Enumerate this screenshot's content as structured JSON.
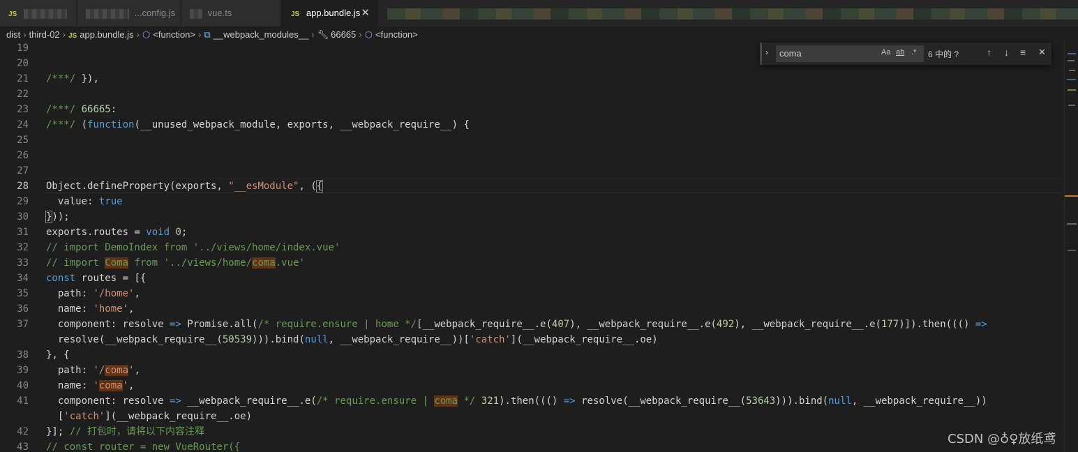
{
  "tabs": [
    {
      "label": "",
      "icon": "JS"
    },
    {
      "label": "...config.js"
    },
    {
      "label": "vue.ts"
    },
    {
      "label": "app.bundle.js",
      "icon": "JS",
      "active": true
    }
  ],
  "breadcrumb": {
    "items": [
      "dist",
      "third-02",
      "app.bundle.js",
      "<function>",
      "__webpack_modules__",
      "66665",
      "<function>"
    ]
  },
  "find": {
    "value": "coma",
    "match_case": "Aa",
    "whole_word": "ab",
    "regex": ".*",
    "count": "6 中的 ?",
    "prev": "↑",
    "next": "↓",
    "selection": "≡",
    "close": "✕",
    "toggle": "›"
  },
  "code": {
    "lines": [
      {
        "n": "19",
        "segs": []
      },
      {
        "n": "20",
        "segs": []
      },
      {
        "n": "21",
        "segs": [
          {
            "t": "/***/",
            "c": "c"
          },
          {
            "t": " }),",
            "c": "d"
          }
        ]
      },
      {
        "n": "22",
        "segs": []
      },
      {
        "n": "23",
        "segs": [
          {
            "t": "/***/",
            "c": "c"
          },
          {
            "t": " ",
            "c": "d"
          },
          {
            "t": "66665",
            "c": "n"
          },
          {
            "t": ":",
            "c": "d"
          }
        ]
      },
      {
        "n": "24",
        "segs": [
          {
            "t": "/***/",
            "c": "c"
          },
          {
            "t": " (",
            "c": "d"
          },
          {
            "t": "function",
            "c": "k"
          },
          {
            "t": "(__unused_webpack_module, exports, __webpack_require__) {",
            "c": "d"
          }
        ]
      },
      {
        "n": "25",
        "segs": []
      },
      {
        "n": "26",
        "segs": []
      },
      {
        "n": "27",
        "segs": []
      },
      {
        "n": "28",
        "current": true,
        "segs": [
          {
            "t": "Object.defineProperty(exports, ",
            "c": "d"
          },
          {
            "t": "\"__esModule\"",
            "c": "s"
          },
          {
            "t": ", (",
            "c": "d"
          },
          {
            "t": "{",
            "c": "d br"
          }
        ]
      },
      {
        "n": "29",
        "segs": [
          {
            "t": "  value: ",
            "c": "d"
          },
          {
            "t": "true",
            "c": "k"
          }
        ]
      },
      {
        "n": "30",
        "segs": [
          {
            "t": "}",
            "c": "d br"
          },
          {
            "t": "));",
            "c": "d"
          }
        ]
      },
      {
        "n": "31",
        "segs": [
          {
            "t": "exports.routes = ",
            "c": "d"
          },
          {
            "t": "void",
            "c": "k"
          },
          {
            "t": " ",
            "c": "d"
          },
          {
            "t": "0",
            "c": "n"
          },
          {
            "t": ";",
            "c": "d"
          }
        ]
      },
      {
        "n": "32",
        "segs": [
          {
            "t": "// import DemoIndex from '../views/home/index.vue'",
            "c": "c"
          }
        ]
      },
      {
        "n": "33",
        "segs": [
          {
            "t": "// import ",
            "c": "c"
          },
          {
            "t": "Coma",
            "c": "c hl"
          },
          {
            "t": " from '../views/home/",
            "c": "c"
          },
          {
            "t": "coma",
            "c": "c hl"
          },
          {
            "t": ".vue'",
            "c": "c"
          }
        ]
      },
      {
        "n": "34",
        "segs": [
          {
            "t": "const",
            "c": "k"
          },
          {
            "t": " routes = [{",
            "c": "d"
          }
        ]
      },
      {
        "n": "35",
        "segs": [
          {
            "t": "  path: ",
            "c": "d"
          },
          {
            "t": "'/home'",
            "c": "s"
          },
          {
            "t": ",",
            "c": "d"
          }
        ]
      },
      {
        "n": "36",
        "segs": [
          {
            "t": "  name: ",
            "c": "d"
          },
          {
            "t": "'home'",
            "c": "s"
          },
          {
            "t": ",",
            "c": "d"
          }
        ]
      },
      {
        "n": "37",
        "segs": [
          {
            "t": "  component: resolve ",
            "c": "d"
          },
          {
            "t": "=>",
            "c": "k"
          },
          {
            "t": " Promise.all(",
            "c": "d"
          },
          {
            "t": "/* require.ensure | home */",
            "c": "c"
          },
          {
            "t": "[__webpack_require__.e(",
            "c": "d"
          },
          {
            "t": "407",
            "c": "n"
          },
          {
            "t": "), __webpack_require__.e(",
            "c": "d"
          },
          {
            "t": "492",
            "c": "n"
          },
          {
            "t": "), __webpack_require__.e(",
            "c": "d"
          },
          {
            "t": "177",
            "c": "n"
          },
          {
            "t": ")]).then((() ",
            "c": "d"
          },
          {
            "t": "=>",
            "c": "k"
          }
        ]
      },
      {
        "n": "",
        "segs": [
          {
            "t": "  resolve(__webpack_require__(",
            "c": "d"
          },
          {
            "t": "50539",
            "c": "n"
          },
          {
            "t": "))).bind(",
            "c": "d"
          },
          {
            "t": "null",
            "c": "k"
          },
          {
            "t": ", __webpack_require__))[",
            "c": "d"
          },
          {
            "t": "'catch'",
            "c": "s"
          },
          {
            "t": "](__webpack_require__.oe)",
            "c": "d"
          }
        ]
      },
      {
        "n": "38",
        "segs": [
          {
            "t": "}, {",
            "c": "d"
          }
        ]
      },
      {
        "n": "39",
        "segs": [
          {
            "t": "  path: ",
            "c": "d"
          },
          {
            "t": "'/",
            "c": "s"
          },
          {
            "t": "coma",
            "c": "s hl"
          },
          {
            "t": "'",
            "c": "s"
          },
          {
            "t": ",",
            "c": "d"
          }
        ]
      },
      {
        "n": "40",
        "segs": [
          {
            "t": "  name: ",
            "c": "d"
          },
          {
            "t": "'",
            "c": "s"
          },
          {
            "t": "coma",
            "c": "s hl"
          },
          {
            "t": "'",
            "c": "s"
          },
          {
            "t": ",",
            "c": "d"
          }
        ]
      },
      {
        "n": "41",
        "segs": [
          {
            "t": "  component: resolve ",
            "c": "d"
          },
          {
            "t": "=>",
            "c": "k"
          },
          {
            "t": " __webpack_require__.e(",
            "c": "d"
          },
          {
            "t": "/* require.ensure | ",
            "c": "c"
          },
          {
            "t": "coma",
            "c": "c hl"
          },
          {
            "t": " */",
            "c": "c"
          },
          {
            "t": " ",
            "c": "d"
          },
          {
            "t": "321",
            "c": "n"
          },
          {
            "t": ").then((() ",
            "c": "d"
          },
          {
            "t": "=>",
            "c": "k"
          },
          {
            "t": " resolve(__webpack_require__(",
            "c": "d"
          },
          {
            "t": "53643",
            "c": "n"
          },
          {
            "t": "))).bind(",
            "c": "d"
          },
          {
            "t": "null",
            "c": "k"
          },
          {
            "t": ", __webpack_require__))",
            "c": "d"
          }
        ]
      },
      {
        "n": "",
        "segs": [
          {
            "t": "  [",
            "c": "d"
          },
          {
            "t": "'catch'",
            "c": "s"
          },
          {
            "t": "](__webpack_require__.oe)",
            "c": "d"
          }
        ]
      },
      {
        "n": "42",
        "segs": [
          {
            "t": "}]; ",
            "c": "d"
          },
          {
            "t": "// 打包时，请将以下内容注释",
            "c": "c"
          }
        ]
      },
      {
        "n": "43",
        "segs": [
          {
            "t": "// const router = new VueRouter({",
            "c": "c"
          }
        ]
      }
    ]
  },
  "watermark": "CSDN @♁♀放纸鸢",
  "colors": {
    "background": "#1e1e1e",
    "comment": "#6a9955",
    "keyword": "#569cd6",
    "string": "#ce9178",
    "number": "#b5cea8",
    "find_highlight": "#613214"
  }
}
